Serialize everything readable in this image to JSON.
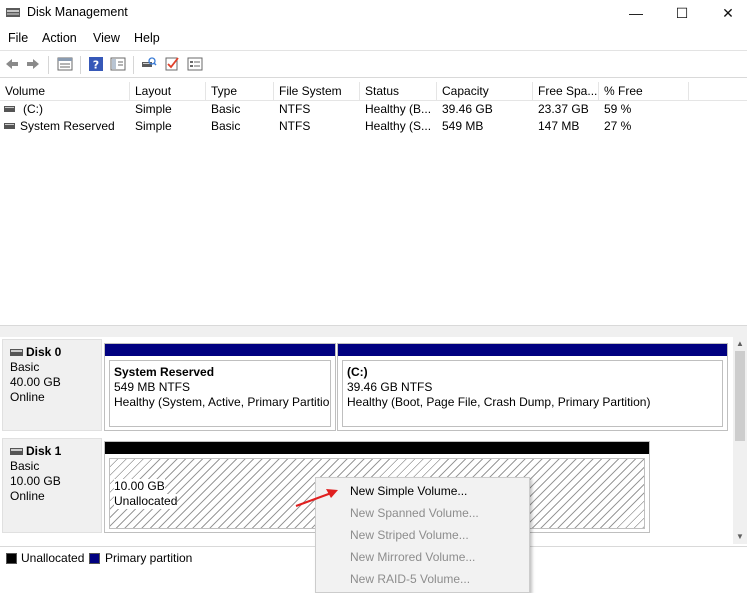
{
  "window": {
    "title": "Disk Management",
    "controls": {
      "minimize": "—",
      "maximize": "☐",
      "close": "✕"
    }
  },
  "menu": [
    "File",
    "Action",
    "View",
    "Help"
  ],
  "toolbar": {
    "buttons": [
      "back-icon",
      "forward-icon",
      "properties-list-icon",
      "help-icon",
      "console-tree-icon",
      "rescan-disks-icon",
      "check-icon",
      "settings-icon"
    ]
  },
  "volume_list": {
    "columns": [
      "Volume",
      "Layout",
      "Type",
      "File System",
      "Status",
      "Capacity",
      "Free Spa...",
      "% Free"
    ],
    "rows": [
      {
        "volume": "(C:)",
        "layout": "Simple",
        "type": "Basic",
        "fs": "NTFS",
        "status": "Healthy (B...",
        "capacity": "39.46 GB",
        "free": "23.37 GB",
        "pct": "59 %"
      },
      {
        "volume": "System Reserved",
        "layout": "Simple",
        "type": "Basic",
        "fs": "NTFS",
        "status": "Healthy (S...",
        "capacity": "549 MB",
        "free": "147 MB",
        "pct": "27 %"
      }
    ]
  },
  "disks": [
    {
      "name": "Disk 0",
      "kind": "Basic",
      "size": "40.00 GB",
      "state": "Online",
      "partitions": [
        {
          "name": "System Reserved",
          "size_fs": "549 MB NTFS",
          "status": "Healthy (System, Active, Primary Partition)"
        },
        {
          "name": "(C:)",
          "size_fs": "39.46 GB NTFS",
          "status": "Healthy (Boot, Page File, Crash Dump, Primary Partition)"
        }
      ]
    },
    {
      "name": "Disk 1",
      "kind": "Basic",
      "size": "10.00 GB",
      "state": "Online",
      "partitions": [
        {
          "size": "10.00 GB",
          "label": "Unallocated"
        }
      ]
    }
  ],
  "legend": [
    {
      "label": "Unallocated",
      "color": "#000000"
    },
    {
      "label": "Primary partition",
      "color": "#000080"
    }
  ],
  "context_menu": {
    "items": [
      {
        "label": "New Simple Volume...",
        "enabled": true
      },
      {
        "label": "New Spanned Volume...",
        "enabled": false
      },
      {
        "label": "New Striped Volume...",
        "enabled": false
      },
      {
        "label": "New Mirrored Volume...",
        "enabled": false
      },
      {
        "label": "New RAID-5 Volume...",
        "enabled": false
      }
    ]
  },
  "colors": {
    "primary_partition": "#000080",
    "unallocated": "#000000",
    "annotation_arrow": "#e02020"
  }
}
